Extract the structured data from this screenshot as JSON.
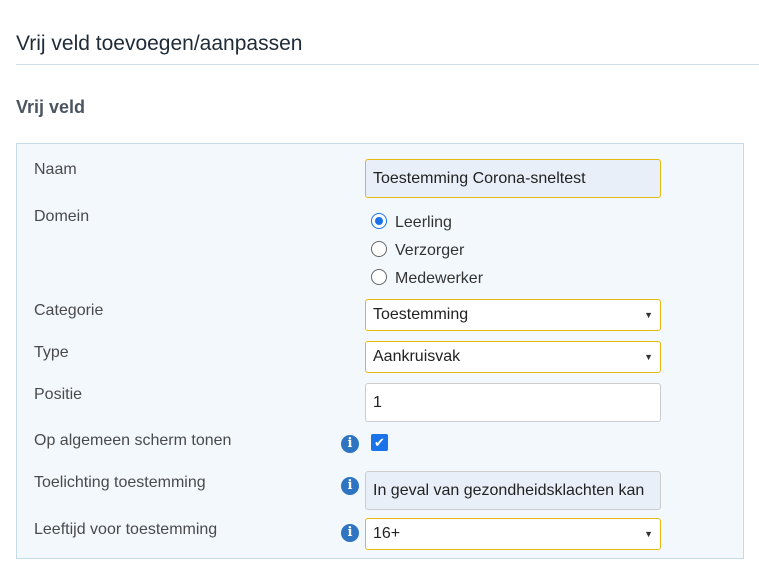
{
  "page": {
    "title": "Vrij veld toevoegen/aanpassen"
  },
  "section": {
    "title": "Vrij veld"
  },
  "form": {
    "naam": {
      "label": "Naam",
      "value": "Toestemming Corona-sneltest"
    },
    "domein": {
      "label": "Domein",
      "options": [
        "Leerling",
        "Verzorger",
        "Medewerker"
      ],
      "selected": "Leerling"
    },
    "categorie": {
      "label": "Categorie",
      "value": "Toestemming"
    },
    "type": {
      "label": "Type",
      "value": "Aankruisvak"
    },
    "positie": {
      "label": "Positie",
      "value": "1"
    },
    "op_algemeen_scherm": {
      "label": "Op algemeen scherm tonen",
      "checked": true
    },
    "toelichting": {
      "label": "Toelichting toestemming",
      "value": "In geval van gezondheidsklachten kan"
    },
    "leeftijd": {
      "label": "Leeftijd voor toestemming",
      "value": "16+"
    }
  },
  "icons": {
    "info": "info-icon",
    "select_arrow": "caret-down-icon",
    "check": "checkmark-icon"
  },
  "colors": {
    "accent": "#1a73e8",
    "focus_border": "#e8b90d",
    "info": "#2f74c0",
    "panel_bg": "#f2f8fc"
  }
}
